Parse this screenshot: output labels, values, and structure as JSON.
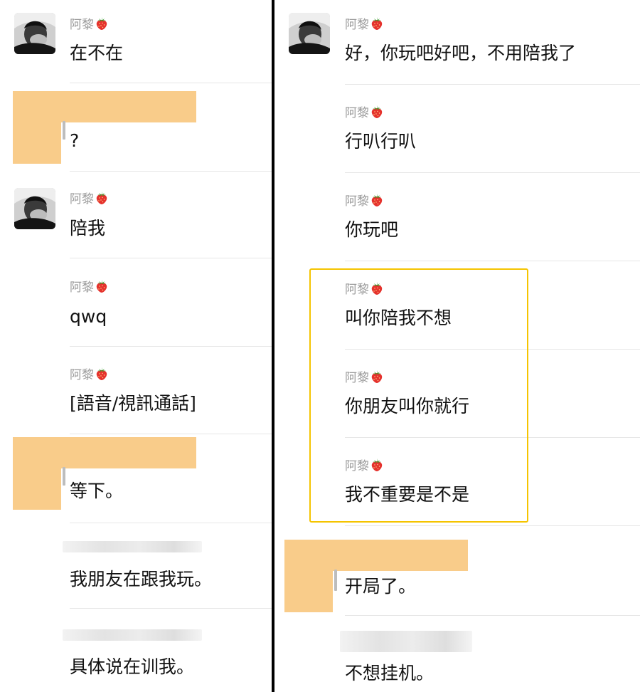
{
  "colors": {
    "highlight": "#f5c400",
    "redact": "#f9cc8a",
    "divider": "#000000",
    "sender": "#9a9a9a"
  },
  "icons": {
    "reaction": "strawberry-emoji",
    "avatar": "user-avatar-photo"
  },
  "left_panel": {
    "messages": [
      {
        "sender": "阿黎",
        "text": "在不在"
      },
      {
        "sender": "",
        "text": "?"
      },
      {
        "sender": "阿黎",
        "text": "陪我"
      },
      {
        "sender": "阿黎",
        "text": "qwq"
      },
      {
        "sender": "阿黎",
        "text": "[語音/視訊通話]"
      },
      {
        "sender": "",
        "text": "等下。"
      },
      {
        "sender": "",
        "text": "我朋友在跟我玩。"
      },
      {
        "sender": "",
        "text": "具体说在训我。"
      }
    ]
  },
  "right_panel": {
    "messages": [
      {
        "sender": "阿黎",
        "text": "好，你玩吧好吧，不用陪我了"
      },
      {
        "sender": "阿黎",
        "text": "行叭行叭"
      },
      {
        "sender": "阿黎",
        "text": "你玩吧"
      },
      {
        "sender": "阿黎",
        "text": "叫你陪我不想"
      },
      {
        "sender": "阿黎",
        "text": "你朋友叫你就行"
      },
      {
        "sender": "阿黎",
        "text": "我不重要是不是"
      },
      {
        "sender": "",
        "text": "开局了。"
      },
      {
        "sender": "",
        "text": "不想挂机。"
      }
    ]
  }
}
